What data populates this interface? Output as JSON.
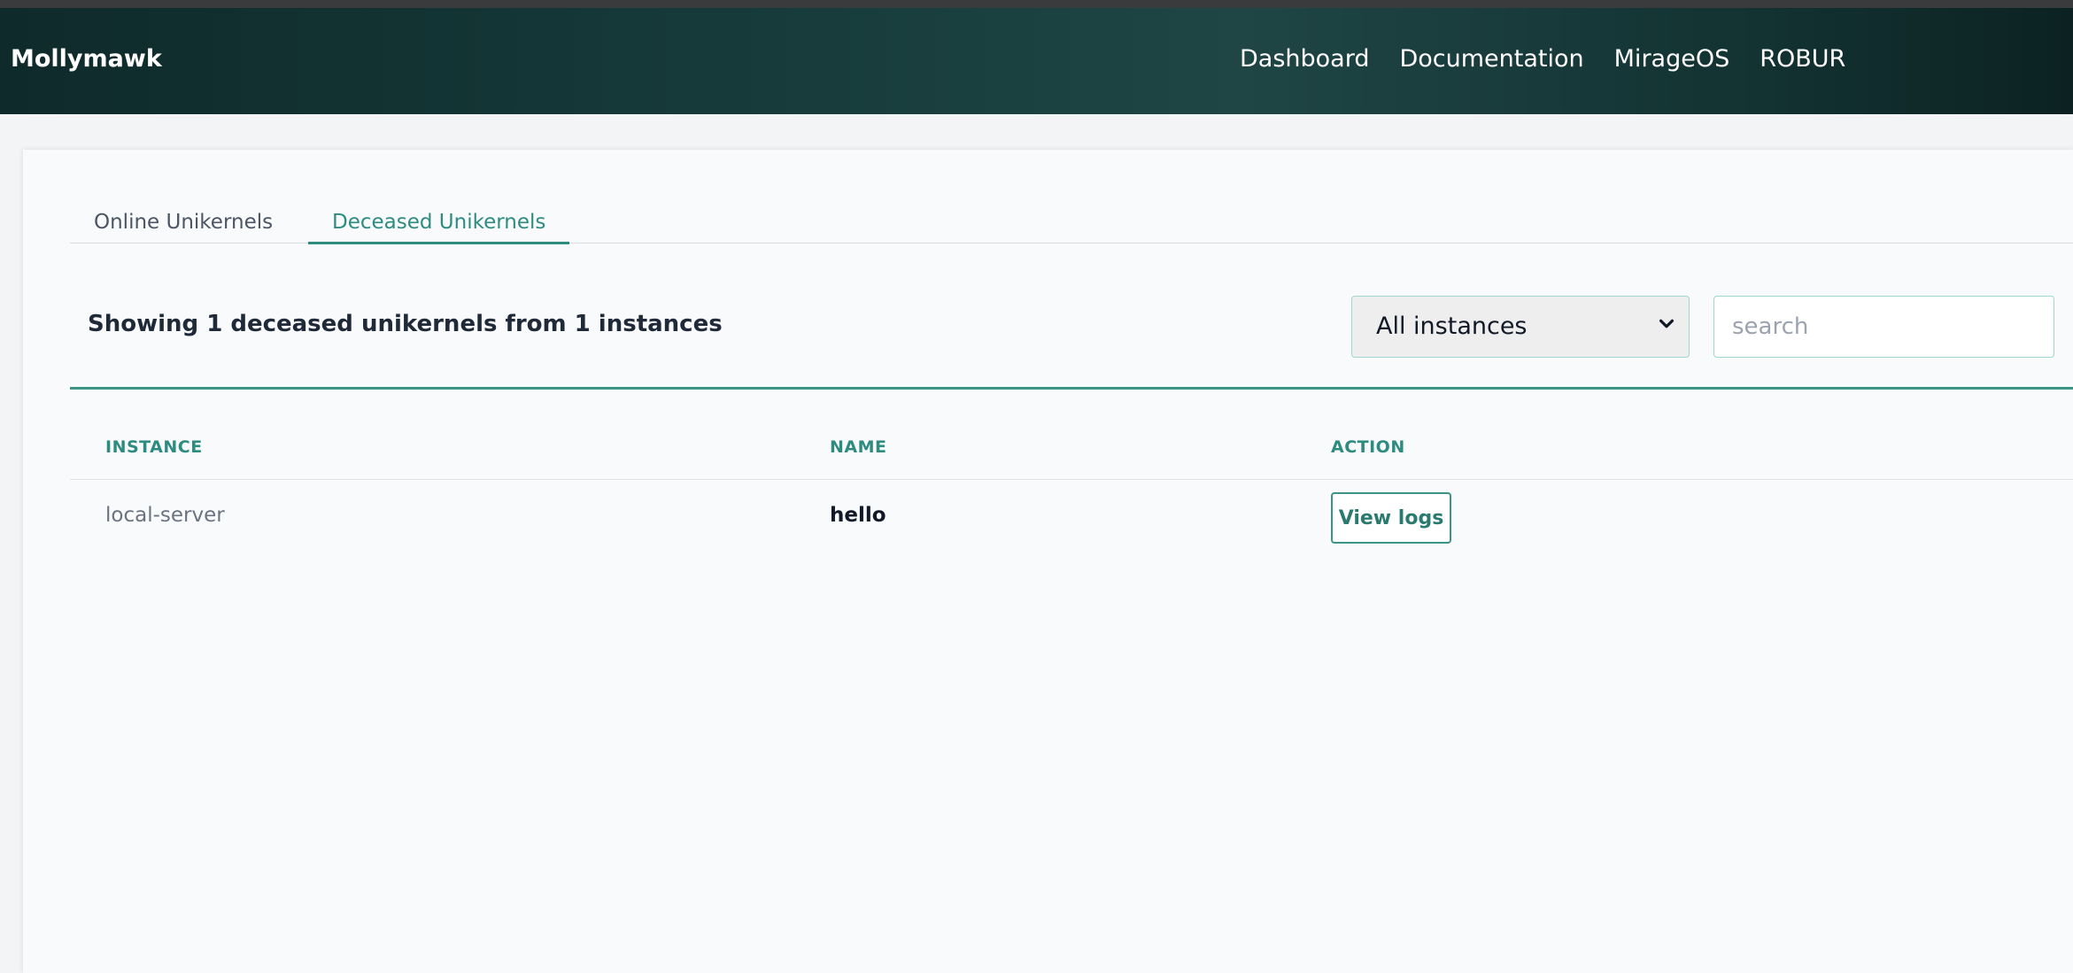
{
  "nav": {
    "brand": "Mollymawk",
    "links": [
      "Dashboard",
      "Documentation",
      "MirageOS",
      "ROBUR"
    ]
  },
  "tabs": [
    {
      "label": "Online Unikernels",
      "active": false
    },
    {
      "label": "Deceased Unikernels",
      "active": true
    }
  ],
  "summary": "Showing 1 deceased unikernels from 1 instances",
  "filter": {
    "selected": "All instances",
    "icon": "chevron-down-icon"
  },
  "search": {
    "placeholder": "search",
    "value": ""
  },
  "table": {
    "headers": [
      "INSTANCE",
      "NAME",
      "ACTION"
    ],
    "rows": [
      {
        "instance": "local-server",
        "name": "hello",
        "action": "View logs"
      }
    ]
  },
  "colors": {
    "accent": "#2e8b80",
    "navbar_dark": "#163a3a",
    "page_bg": "#f3f4f6"
  }
}
